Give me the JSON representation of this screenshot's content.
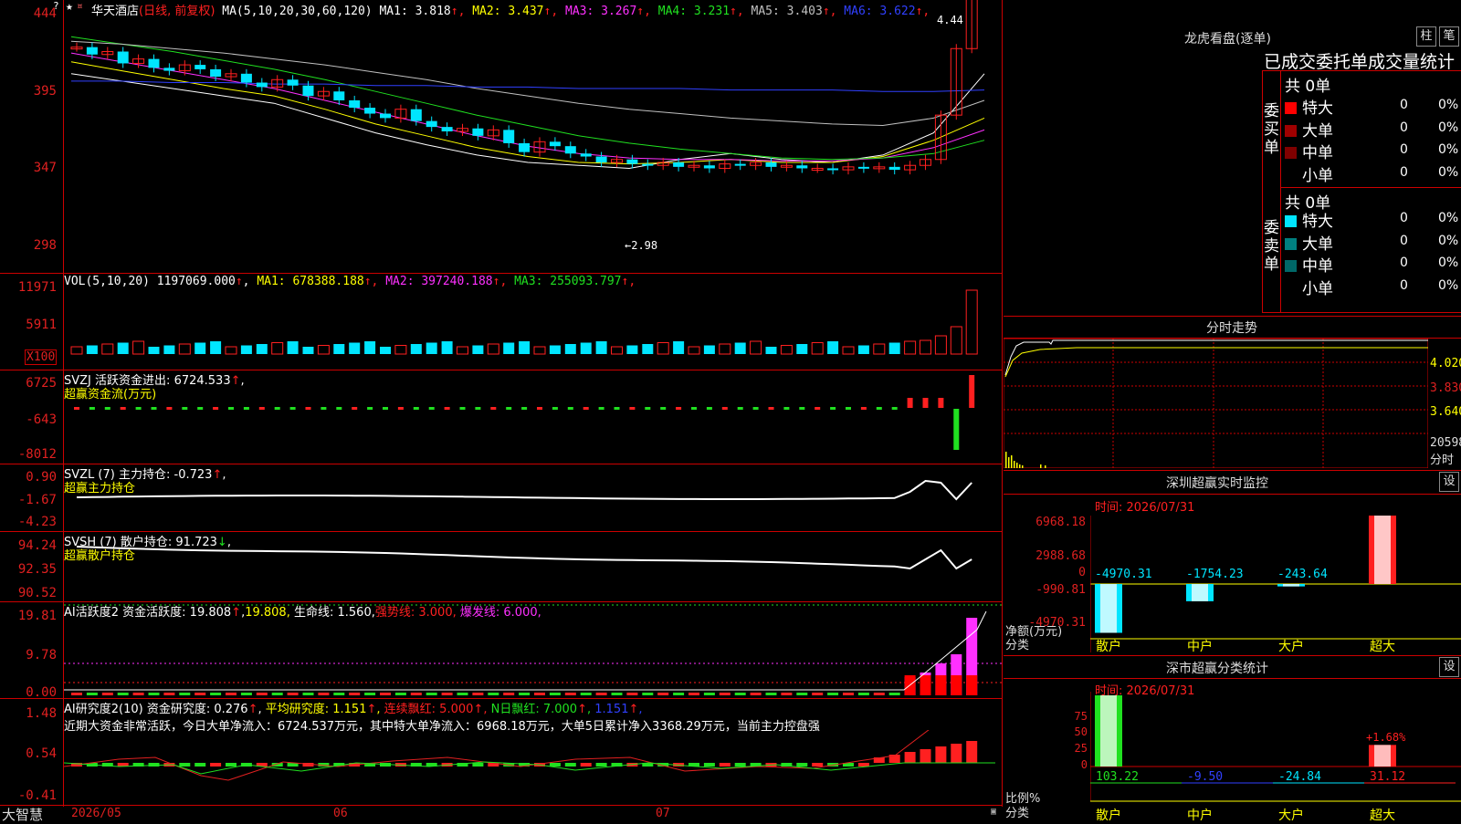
{
  "stock": {
    "name": "华天酒店",
    "period": "(日线, 前复权)",
    "ma_label": "MA(5,10,20,30,60,120)",
    "ma": [
      {
        "label": "MA1:",
        "value": "3.818",
        "dir": "↑",
        "color": "#ffffff"
      },
      {
        "label": "MA2:",
        "value": "3.437",
        "dir": "↑",
        "color": "#ffff00"
      },
      {
        "label": "MA3:",
        "value": "3.267",
        "dir": "↑",
        "color": "#ff30ff"
      },
      {
        "label": "MA4:",
        "value": "3.231",
        "dir": "↑",
        "color": "#20e020"
      },
      {
        "label": "MA5:",
        "value": "3.403",
        "dir": "↑",
        "color": "#c0c0c0"
      },
      {
        "label": "MA6:",
        "value": "3.622",
        "dir": "↑",
        "color": "#3040ff"
      }
    ],
    "high_label": "4.44",
    "low_label": "←2.98"
  },
  "price_axis": [
    "444",
    "395",
    "347",
    "298"
  ],
  "vol": {
    "axis": [
      "11971",
      "5911",
      "X100"
    ],
    "label": "VOL(5,10,20)",
    "value": "1197069.000",
    "ma": [
      {
        "label": "MA1:",
        "value": "678388.188",
        "color": "#ffff00"
      },
      {
        "label": "MA2:",
        "value": "397240.188",
        "color": "#ff30ff"
      },
      {
        "label": "MA3:",
        "value": "255093.797",
        "color": "#20e020"
      }
    ]
  },
  "svzj": {
    "axis": [
      "6725",
      "-643",
      "-8012"
    ],
    "name": "SVZJ",
    "desc": "活跃资金进出:",
    "value": "6724.533",
    "title": "超赢资金流(万元)"
  },
  "svzl": {
    "axis": [
      "0.90",
      "-1.67",
      "-4.23"
    ],
    "name": "SVZL (7)",
    "desc": "主力持仓:",
    "value": "-0.723",
    "title": "超赢主力持仓"
  },
  "svsh": {
    "axis": [
      "94.24",
      "92.35",
      "90.52"
    ],
    "name": "SVSH (7)",
    "desc": "散户持仓:",
    "value": "91.723",
    "title": "超赢散户持仓"
  },
  "ai_active": {
    "axis": [
      "19.81",
      "9.78",
      "0.00"
    ],
    "name": "AI活跃度2",
    "desc": "资金活跃度:",
    "value": "19.808",
    "value2": "19.808",
    "life": "生命线: 1.560",
    "strong": "强势线: 3.000",
    "burst": "爆发线: 6.000"
  },
  "ai_research": {
    "axis": [
      "1.48",
      "0.54",
      "-0.41"
    ],
    "name": "AI研究度2(10)",
    "desc": "资金研究度:",
    "value": "0.276",
    "avg": "平均研究度: 1.151",
    "streak": "连续飘红: 5.000",
    "nday": "N日飘红: 7.000",
    "last": "1.151",
    "comment": "近期大资金非常活跃，今日大单净流入：6724.537万元，其中特大单净流入：6968.18万元，大单5日累计净入3368.29万元，当前主力控盘强"
  },
  "dates": [
    "2026/05",
    "06",
    "07"
  ],
  "brand": "大智慧",
  "lhb": {
    "title": "龙虎看盘(逐单)",
    "btn1": "柱",
    "btn2": "笔",
    "subtitle": "已成交委托单成交量统计",
    "buy_label": "委买单",
    "sell_label": "委卖单",
    "buy_total": "共 0单",
    "sell_total": "共 0单",
    "buy_rows": [
      {
        "name": "特大",
        "count": "0",
        "pct": "0%",
        "color": "#ff0000"
      },
      {
        "name": "大单",
        "count": "0",
        "pct": "0%",
        "color": "#a00000"
      },
      {
        "name": "中单",
        "count": "0",
        "pct": "0%",
        "color": "#800000"
      },
      {
        "name": "小单",
        "count": "0",
        "pct": "0%",
        "color": "#000000"
      }
    ],
    "sell_rows": [
      {
        "name": "特大",
        "count": "0",
        "pct": "0%",
        "color": "#00e5ff"
      },
      {
        "name": "大单",
        "count": "0",
        "pct": "0%",
        "color": "#008080"
      },
      {
        "name": "中单",
        "count": "0",
        "pct": "0%",
        "color": "#006868"
      },
      {
        "name": "小单",
        "count": "0",
        "pct": "0%",
        "color": "#000000"
      }
    ]
  },
  "intraday": {
    "title": "分时走势",
    "axis": [
      "4.020",
      "3.830",
      "3.640"
    ],
    "vol_label": "20598",
    "vol_unit": "分时"
  },
  "monitor": {
    "title": "深圳超赢实时监控",
    "btn": "设",
    "time": "时间: 2026/07/31",
    "axis": [
      "6968.18",
      "2988.68",
      "0",
      "-990.81",
      "-4970.31"
    ],
    "unit1": "净额(万元)",
    "unit2": "分类",
    "values": [
      "-4970.31",
      "-1754.23",
      "-243.64",
      "6968.18"
    ],
    "categories": [
      "散户",
      "中户",
      "大户",
      "超大"
    ]
  },
  "classify": {
    "title": "深市超赢分类统计",
    "btn": "设",
    "time": "时间: 2026/07/31",
    "axis": [
      "75",
      "50",
      "25",
      "0"
    ],
    "unit1": "比例%",
    "unit2": "分类",
    "values": [
      "103.22",
      "-9.50",
      "-24.84",
      "31.12"
    ],
    "note": "+1.68%",
    "categories": [
      "散户",
      "中户",
      "大户",
      "超大"
    ]
  },
  "colors": {
    "up": "#ff2020",
    "down": "#00e5ff",
    "grid": "#cc0000"
  }
}
